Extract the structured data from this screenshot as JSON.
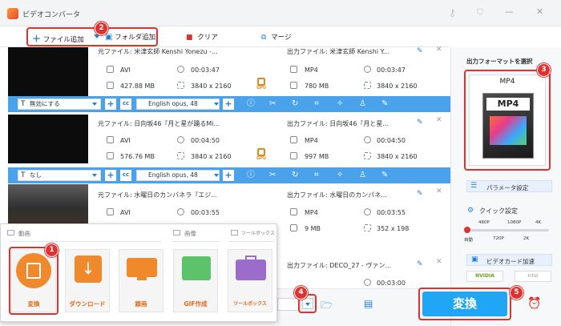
{
  "app": {
    "title": "ビデオコンバータ"
  },
  "toolbar": {
    "add_file": "ファイル追加",
    "add_folder": "フォルダ追加",
    "clear": "クリア",
    "merge": "マージ"
  },
  "rows": [
    {
      "src_name": "元ファイル: 米津玄師 Kenshi Yonezu -...",
      "src_format": "AVI",
      "src_duration": "00:03:47",
      "src_size": "427.88 MB",
      "src_res": "3840 x 2160",
      "out_name": "出力ファイル: 米津玄師 Kenshi Y...",
      "out_format": "MP4",
      "out_duration": "00:03:47",
      "out_size": "780 MB",
      "out_res": "3840 x 2160",
      "subtitle": "無効にする",
      "audio": "English opus, 48"
    },
    {
      "src_name": "元ファイル: 日向坂46『月と星が踊るMi...",
      "src_format": "AVI",
      "src_duration": "00:04:50",
      "src_size": "576.76 MB",
      "src_res": "3840 x 2160",
      "out_name": "出力ファイル: 日向坂46『月と星...",
      "out_format": "MP4",
      "out_duration": "00:04:50",
      "out_size": "997 MB",
      "out_res": "3840 x 2160",
      "subtitle": "なし",
      "audio": "English opus, 48"
    },
    {
      "src_name": "元ファイル: 水曜日のカンパネラ『エジ...",
      "src_format": "AVI",
      "src_duration": "00:03:55",
      "src_size": "",
      "src_res": "",
      "out_name": "出力ファイル: 水曜日のカンパネ...",
      "out_format": "MP4",
      "out_duration": "00:03:55",
      "out_size": "9 MB",
      "out_res": "352 x 198"
    },
    {
      "out_name": "出力ファイル: DECO_27 - ヴァン...",
      "out_duration": "00:03:00"
    }
  ],
  "gpu_label": "GPU",
  "right_panel": {
    "heading": "出力フォーマットを選択",
    "format": "MP4",
    "params_button": "パラメータ設定",
    "quick_label": "クイック設定",
    "quick_top": [
      "480P",
      "1080P",
      "4K"
    ],
    "quick_bottom": [
      "自動",
      "720P",
      "2K"
    ],
    "hw_accel": "ビデオカード加速",
    "nvidia": "NVIDIA",
    "intel": "Intel"
  },
  "convert_button": "変換",
  "popup": {
    "sec_video": "動画",
    "sec_image": "画像",
    "sec_toolbox": "ツールボックス",
    "items": [
      "変換",
      "ダウンロード",
      "録画",
      "GIF作成",
      "ツールボックス"
    ]
  },
  "badges": [
    "1",
    "2",
    "3",
    "4",
    "5"
  ],
  "colors": {
    "accent": "#1e7fd8",
    "strip": "#4aa3ea",
    "highlight": "#e0312f",
    "popup_orange": "#f0892b",
    "gif_green": "#5cc36a",
    "toolbox_purple": "#9b6cc9"
  }
}
